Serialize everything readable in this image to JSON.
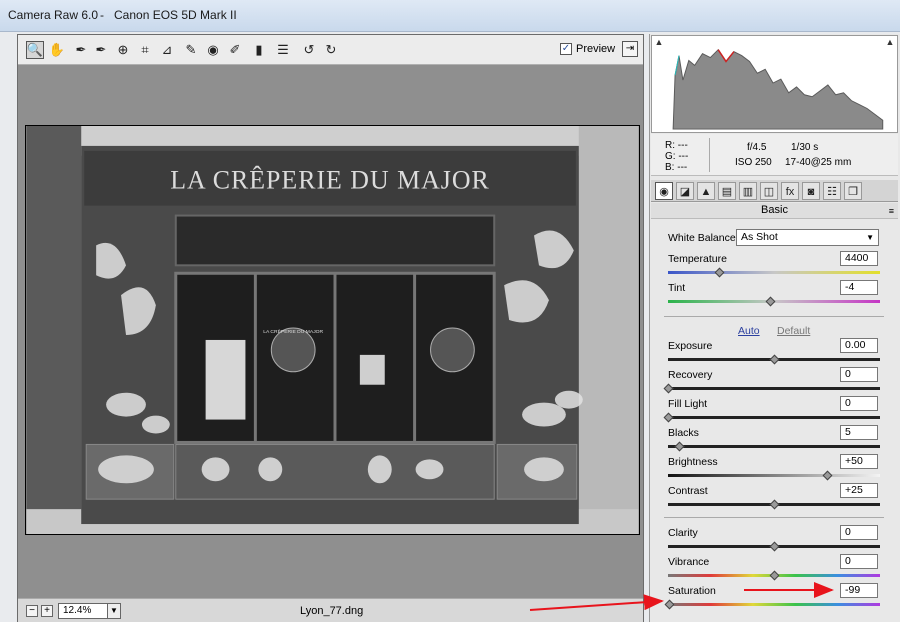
{
  "window": {
    "app_title": "Camera Raw 6.0",
    "separator": "-",
    "camera": "Canon EOS 5D Mark II"
  },
  "toolbar": {
    "tools": [
      {
        "icon": "zoom-icon",
        "glyph": "🔍"
      },
      {
        "icon": "hand-icon",
        "glyph": "✋"
      },
      {
        "icon": "white-balance-eyedropper-icon",
        "glyph": "✒"
      },
      {
        "icon": "color-sampler-icon",
        "glyph": "✒"
      },
      {
        "icon": "target-adjustment-icon",
        "glyph": "⊕"
      },
      {
        "icon": "crop-icon",
        "glyph": "⌗"
      },
      {
        "icon": "straighten-icon",
        "glyph": "⊿"
      },
      {
        "icon": "spot-removal-icon",
        "glyph": "✎"
      },
      {
        "icon": "red-eye-icon",
        "glyph": "◉"
      },
      {
        "icon": "adjustment-brush-icon",
        "glyph": "✐"
      },
      {
        "icon": "graduated-filter-icon",
        "glyph": "▮"
      },
      {
        "icon": "preferences-icon",
        "glyph": "☰"
      },
      {
        "icon": "rotate-left-icon",
        "glyph": "↺"
      },
      {
        "icon": "rotate-right-icon",
        "glyph": "↻"
      }
    ],
    "preview_label": "Preview",
    "preview_checked": "✓"
  },
  "photo": {
    "sign_text": "LA CRÊPERIE DU MAJOR",
    "window_text": "LA CRÊPERIE DU MAJOR"
  },
  "statusbar": {
    "zoom_minus": "−",
    "zoom_plus": "+",
    "zoom_value": "12.4%",
    "filename": "Lyon_77.dng"
  },
  "readout": {
    "r_label": "R:",
    "r_value": "---",
    "g_label": "G:",
    "g_value": "---",
    "b_label": "B:",
    "b_value": "---",
    "aperture": "f/4.5",
    "shutter": "1/30 s",
    "iso": "ISO 250",
    "lens": "17-40@25 mm"
  },
  "panel": {
    "title": "Basic",
    "menu_icon": "≡",
    "white_balance_label": "White Balance:",
    "white_balance_value": "As Shot",
    "auto_label": "Auto",
    "default_label": "Default",
    "sliders": [
      {
        "label": "Temperature",
        "value": "4400",
        "fraction": 0.24
      },
      {
        "label": "Tint",
        "value": "-4",
        "fraction": 0.48
      },
      {
        "label": "Exposure",
        "value": "0.00",
        "fraction": 0.5
      },
      {
        "label": "Recovery",
        "value": "0",
        "fraction": 0.0
      },
      {
        "label": "Fill Light",
        "value": "0",
        "fraction": 0.0
      },
      {
        "label": "Blacks",
        "value": "5",
        "fraction": 0.05
      },
      {
        "label": "Brightness",
        "value": "+50",
        "fraction": 0.75
      },
      {
        "label": "Contrast",
        "value": "+25",
        "fraction": 0.5
      },
      {
        "label": "Clarity",
        "value": "0",
        "fraction": 0.5
      },
      {
        "label": "Vibrance",
        "value": "0",
        "fraction": 0.5
      },
      {
        "label": "Saturation",
        "value": "-99",
        "fraction": 0.005
      }
    ]
  },
  "colors": {
    "annotation_arrow": "#e8141c",
    "link": "#2b3f9f"
  }
}
